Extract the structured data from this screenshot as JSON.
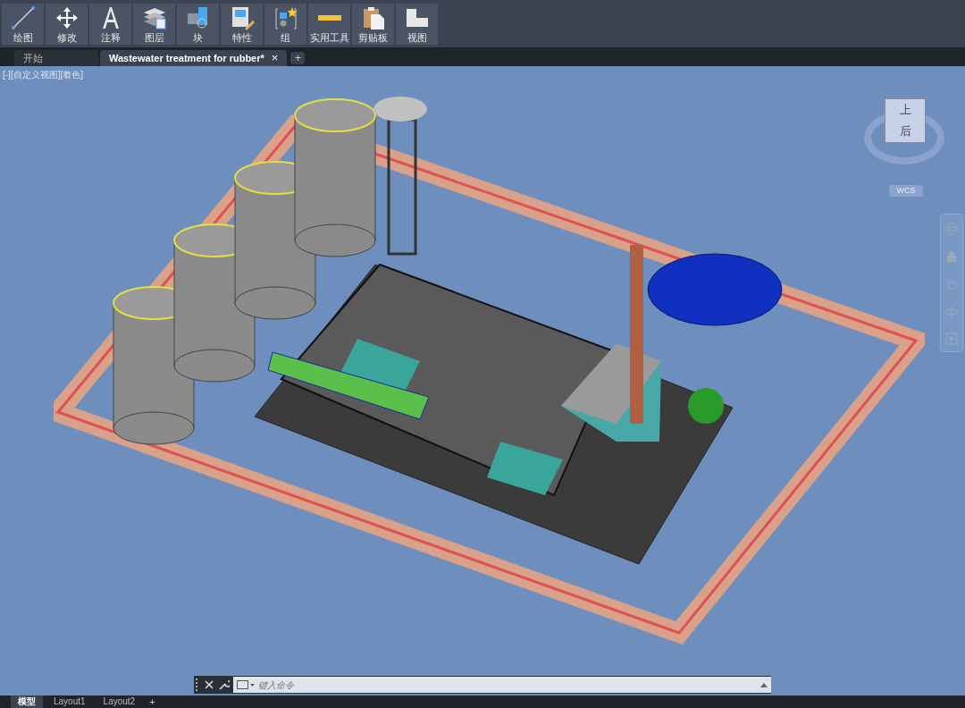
{
  "ribbon": {
    "buttons": [
      {
        "label": "绘图",
        "kind": "draw"
      },
      {
        "label": "修改",
        "kind": "move"
      },
      {
        "label": "注释",
        "kind": "text"
      },
      {
        "label": "图层",
        "kind": "layers"
      },
      {
        "label": "块",
        "kind": "block"
      },
      {
        "label": "特性",
        "kind": "properties"
      },
      {
        "label": "组",
        "kind": "group"
      },
      {
        "label": "实用工具",
        "kind": "ruler"
      },
      {
        "label": "剪贴板",
        "kind": "clipboard"
      },
      {
        "label": "视图",
        "kind": "view"
      }
    ]
  },
  "file_tabs": [
    {
      "label": "开始",
      "selected": false
    },
    {
      "label": "Wastewater treatment for rubber*",
      "selected": true,
      "close_symbol": "×"
    }
  ],
  "new_tab_symbol": "+",
  "viewport": {
    "label": "[-][自定义视图][着色]",
    "viewcube": {
      "top": "上",
      "face": "后"
    },
    "ucs": "WCS"
  },
  "command_line": {
    "placeholder": "键入命令"
  },
  "layout_tabs": [
    {
      "label": "模型",
      "selected": true
    },
    {
      "label": "Layout1",
      "selected": false
    },
    {
      "label": "Layout2",
      "selected": false
    }
  ],
  "new_layout_symbol": "+"
}
